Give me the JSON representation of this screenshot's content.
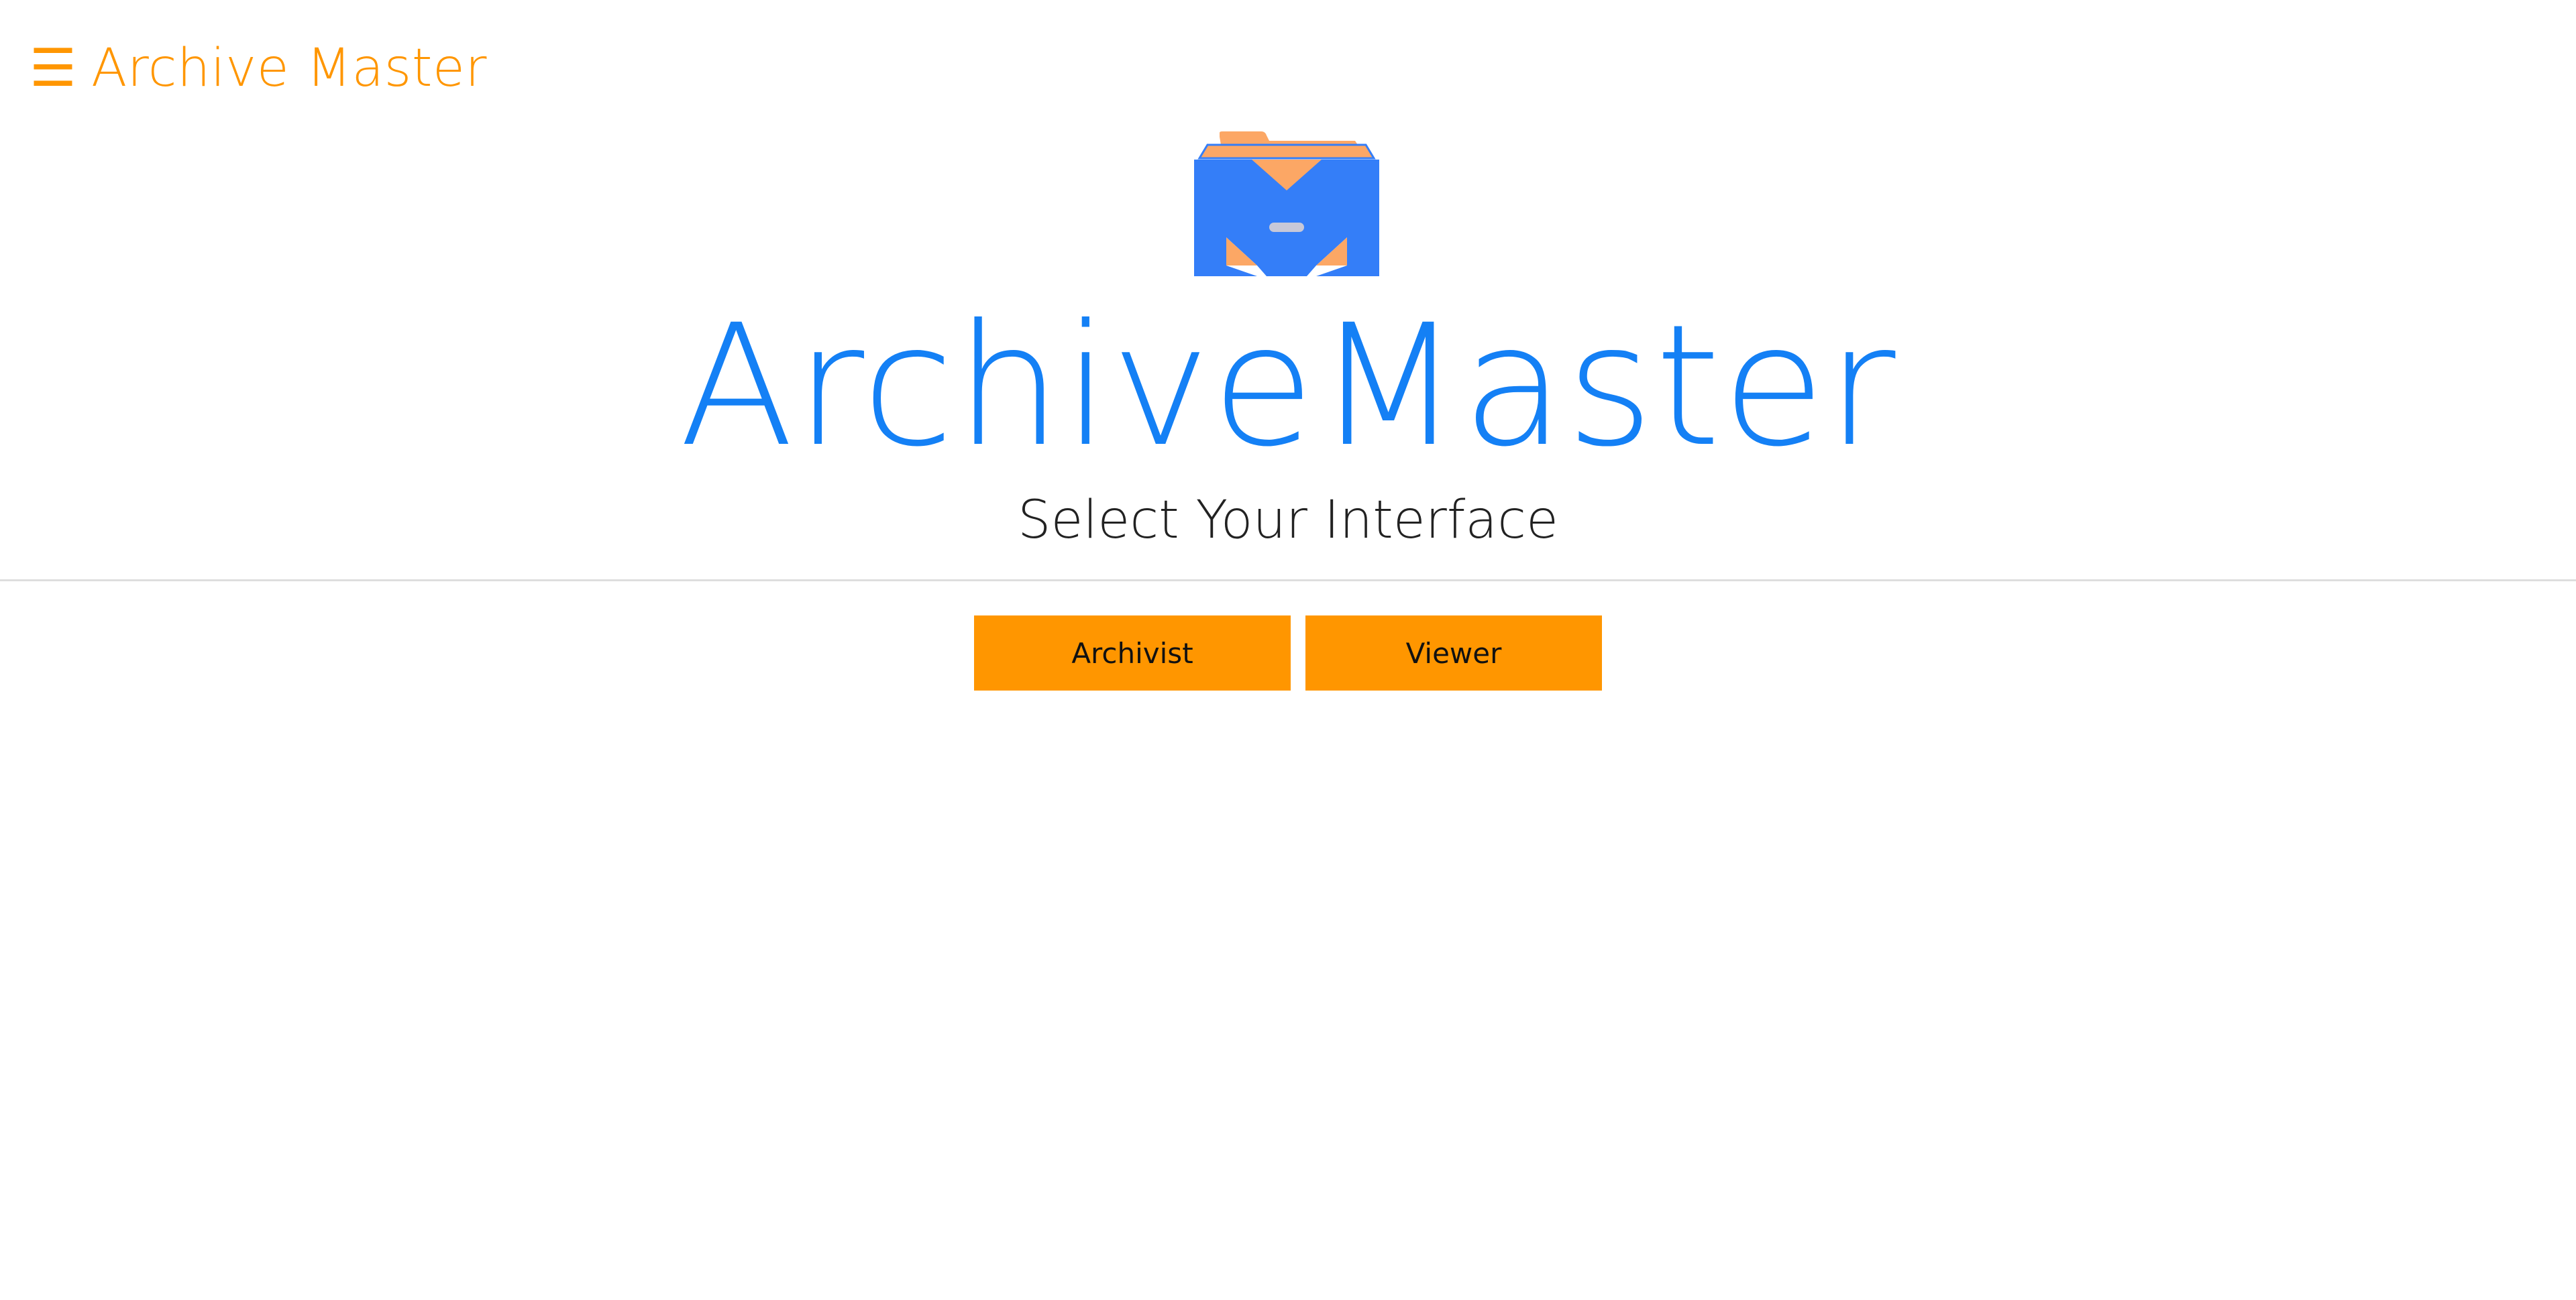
{
  "header": {
    "menu_icon": "hamburger-menu-icon",
    "menu_glyph": "☰",
    "app_name": "Archive Master"
  },
  "logo": {
    "icon": "archive-cabinet-icon",
    "colors": {
      "body": "#347ef8",
      "folder": "#fca765",
      "handle": "#c7c8d8"
    }
  },
  "hero": {
    "title": "ArchiveMaster",
    "subtitle": "Select Your Interface"
  },
  "actions": {
    "archivist_label": "Archivist",
    "viewer_label": "Viewer"
  },
  "colors": {
    "accent": "#ff9600",
    "title_blue": "#1480f5",
    "divider": "#dedede"
  }
}
